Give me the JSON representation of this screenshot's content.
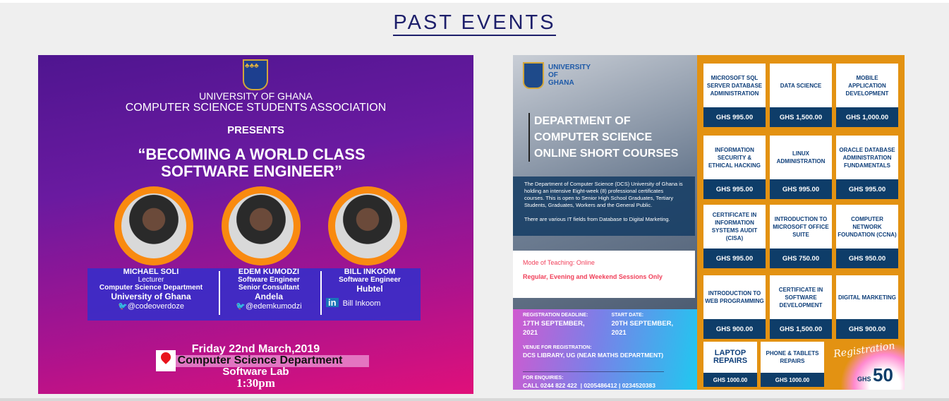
{
  "page": {
    "title": "PAST EVENTS"
  },
  "event1": {
    "org1": "UNIVERSITY OF GHANA",
    "org2": "COMPUTER SCIENCE STUDENTS ASSOCIATION",
    "presents": "PRESENTS",
    "title1": "“BECOMING A WORLD CLASS",
    "title2": "SOFTWARE ENGINEER”",
    "speakers": [
      {
        "name": "MICHAEL SOLI",
        "l1": "Lecturer",
        "l2": "Computer Science Department",
        "org": "University of Ghana",
        "handle": "@codeoverdoze"
      },
      {
        "name": "EDEM KUMODZI",
        "l1": "Software Engineer",
        "l2": "Senior Consultant",
        "org": "Andela",
        "handle": "@edemkumodzi"
      },
      {
        "name": "BILL INKOOM",
        "l1": "Software Engineer",
        "l2": "",
        "org": "Hubtel",
        "handle": "Bill Inkoom"
      }
    ],
    "date": "Friday 22nd March,2019",
    "location1": "Computer Science Department",
    "location2": "Software Lab",
    "time": "1:30pm"
  },
  "event2": {
    "uni": "UNIVERSITY OF GHANA",
    "heading": [
      "DEPARTMENT OF",
      "COMPUTER SCIENCE",
      "ONLINE SHORT COURSES"
    ],
    "desc1": "The Department of Computer Science (DCS) University of Ghana is holding an intensive Eight-week (8) professional certificates courses. This is open to Senior High School Graduates, Tertiary Students, Graduates, Workers and the General Public.",
    "desc2": "There are various IT fields from Database to Digital Marketing.",
    "mode": "Mode of Teaching: Online",
    "sessions": "Regular, Evening and Weekend Sessions Only",
    "deadline_label": "REGISTRATION DEADLINE:",
    "deadline": "17TH SEPTEMBER, 2021",
    "start_label": "START DATE:",
    "start": "20TH SEPTEMBER, 2021",
    "venue_label": "VENUE FOR REGISTRATION:",
    "venue": "DCS LIBRARY, UG (NEAR MATHS DEPARTMENT)",
    "enq_label": "FOR ENQUIRIES:",
    "enq": "CALL 0244 822 422  | 0205486412 | 0234520383",
    "courses": [
      {
        "name": "MICROSOFT SQL SERVER DATABASE ADMINISTRATION",
        "price": "GHS 995.00"
      },
      {
        "name": "DATA SCIENCE",
        "price": "GHS 1,500.00"
      },
      {
        "name": "MOBILE APPLICATION DEVELOPMENT",
        "price": "GHS 1,000.00"
      },
      {
        "name": "INFORMATION SECURITY & ETHICAL HACKING",
        "price": "GHS 995.00"
      },
      {
        "name": "LINUX ADMINISTRATION",
        "price": "GHS 995.00"
      },
      {
        "name": "ORACLE DATABASE ADMINISTRATION FUNDAMENTALS",
        "price": "GHS 995.00"
      },
      {
        "name": "CERTIFICATE IN INFORMATION SYSTEMS AUDIT (CISA)",
        "price": "GHS 995.00"
      },
      {
        "name": "INTRODUCTION TO MICROSOFT OFFICE SUITE",
        "price": "GHS 750.00"
      },
      {
        "name": "COMPUTER NETWORK FOUNDATION (CCNA)",
        "price": "GHS 950.00"
      },
      {
        "name": "INTRODUCTION TO WEB PROGRAMMING",
        "price": "GHS 900.00"
      },
      {
        "name": "CERTIFICATE IN SOFTWARE DEVELOPMENT",
        "price": "GHS 1,500.00"
      },
      {
        "name": "DIGITAL MARKETING",
        "price": "GHS 900.00"
      },
      {
        "name": "LAPTOP REPAIRS",
        "price": "GHS 1000.00"
      },
      {
        "name": "PHONE & TABLETS REPAIRS",
        "price": "GHS 1000.00"
      }
    ],
    "reg_script": "Registration",
    "reg_cur": "GHS",
    "reg_fee": "50"
  }
}
